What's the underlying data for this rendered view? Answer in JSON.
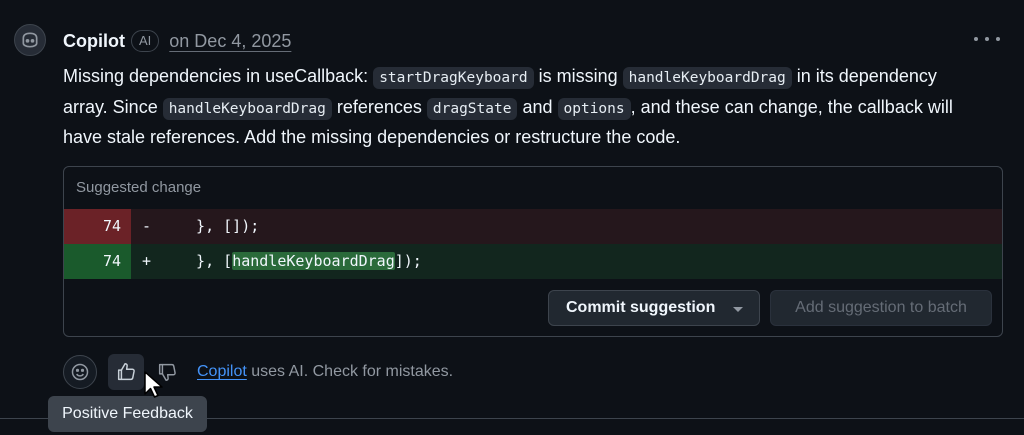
{
  "comment": {
    "author": "Copilot",
    "badge": "AI",
    "date": "on Dec 4, 2025",
    "body": {
      "t1": "Missing dependencies in useCallback: ",
      "c1": "startDragKeyboard",
      "t2": " is missing ",
      "c2": "handleKeyboardDrag",
      "t3": " in its dependency array. Since ",
      "c3": "handleKeyboardDrag",
      "t4": " references ",
      "c4": "dragState",
      "t5": " and ",
      "c5": "options",
      "t6": ", and these can change, the callback will have stale references. Add the missing dependencies or restructure the code."
    }
  },
  "suggestion": {
    "title": "Suggested change",
    "rows": [
      {
        "line": "74",
        "sign": "-",
        "code": "  }, []);"
      },
      {
        "line": "74",
        "sign": "+",
        "code_pre": "  }, [",
        "code_hl": "handleKeyboardDrag",
        "code_post": "]);"
      }
    ],
    "commit_label": "Commit suggestion",
    "batch_label": "Add suggestion to batch"
  },
  "footer": {
    "link": "Copilot",
    "text": " uses AI. Check for mistakes."
  },
  "tooltip": "Positive Feedback",
  "icons": {
    "avatar": "copilot-icon",
    "more": "kebab-horizontal-icon",
    "reaction": "smiley-icon",
    "thumbs_up": "thumbs-up-icon",
    "thumbs_down": "thumbs-down-icon"
  },
  "colors": {
    "background": "#0d1117",
    "deleted_line": "#6b2227",
    "added_line": "#1a5a2c",
    "link": "#4493f8"
  }
}
